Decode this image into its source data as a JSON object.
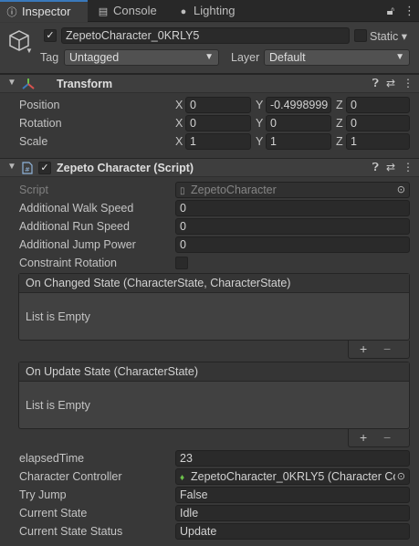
{
  "tabs": [
    {
      "label": "Inspector",
      "icon": "info-icon",
      "active": true
    },
    {
      "label": "Console",
      "icon": "console-icon",
      "active": false
    },
    {
      "label": "Lighting",
      "icon": "lightbulb-icon",
      "active": false
    }
  ],
  "header": {
    "object_name": "ZepetoCharacter_0KRLY5",
    "active_checked": true,
    "static_label": "Static",
    "tag_label": "Tag",
    "tag_value": "Untagged",
    "layer_label": "Layer",
    "layer_value": "Default"
  },
  "transform": {
    "title": "Transform",
    "rows": [
      {
        "label": "Position",
        "x": "0",
        "y": "-0.4998999",
        "z": "0"
      },
      {
        "label": "Rotation",
        "x": "0",
        "y": "0",
        "z": "0"
      },
      {
        "label": "Scale",
        "x": "1",
        "y": "1",
        "z": "1"
      }
    ],
    "axis_x": "X",
    "axis_y": "Y",
    "axis_z": "Z"
  },
  "script_component": {
    "title": "Zepeto Character (Script)",
    "enabled": true,
    "script_label": "Script",
    "script_value": "ZepetoCharacter",
    "fields": [
      {
        "label": "Additional Walk Speed",
        "value": "0"
      },
      {
        "label": "Additional Run Speed",
        "value": "0"
      },
      {
        "label": "Additional Jump Power",
        "value": "0"
      }
    ],
    "constraint_label": "Constraint Rotation",
    "events": [
      {
        "title": "On Changed State (CharacterState, CharacterState)",
        "empty_text": "List is Empty"
      },
      {
        "title": "On Update State (CharacterState)",
        "empty_text": "List is Empty"
      }
    ],
    "plus": "+",
    "minus": "−",
    "bottom_fields": [
      {
        "label": "elapsedTime",
        "value": "23"
      },
      {
        "label": "Character Controller",
        "value": "ZepetoCharacter_0KRLY5 (Character Co"
      },
      {
        "label": "Try Jump",
        "value": "False"
      },
      {
        "label": "Current State",
        "value": "Idle"
      },
      {
        "label": "Current State Status",
        "value": "Update"
      }
    ]
  },
  "colors": {
    "accent": "#3a79bb",
    "background": "#383838",
    "field": "#2a2a2a"
  }
}
